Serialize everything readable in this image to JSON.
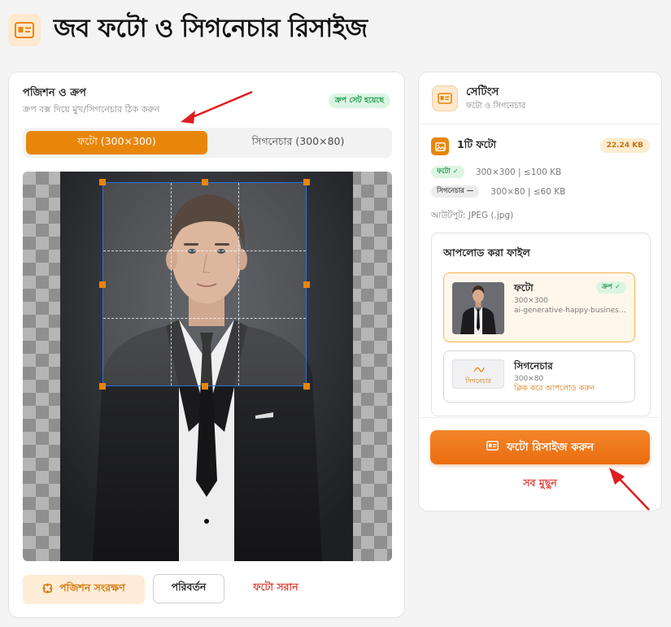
{
  "header": {
    "title": "জব ফটো ও সিগনেচার রিসাইজ",
    "icon": "id-card-icon"
  },
  "editor": {
    "title": "পজিশন ও ক্রপ",
    "subtitle": "ক্রপ বক্স দিয়ে মুখ/সিগনেচার ঠিক করুন",
    "status_badge": "ক্রপ সেট হয়েছে",
    "tabs": [
      {
        "label": "ফটো (300×300)",
        "active": true
      },
      {
        "label": "সিগনেচার (300×80)",
        "active": false
      }
    ],
    "buttons": {
      "save_position": "পজিশন সংরক্ষণ",
      "change": "পরিবর্তন",
      "remove_photo": "ফটো সরান"
    }
  },
  "settings": {
    "title": "সেটিংস",
    "subtitle": "ফটো ও সিগনেচার",
    "photo_count": "1টি ফটো",
    "total_size": "22.24 KB",
    "specs": [
      {
        "pill": "ফটো ✓",
        "text": "300×300 | ≤100 KB",
        "done": true
      },
      {
        "pill": "সিগনেচার —",
        "text": "300×80 | ≤60 KB",
        "done": false
      }
    ],
    "output_format": "আউটপুট: JPEG (.jpg)",
    "uploaded_files": {
      "title": "আপলোড করা ফাইল",
      "photo": {
        "name": "ফটো",
        "dims": "300×300",
        "filename": "ai-generative-happy-business-man-in-suit.jpg",
        "badge": "ক্রপ ✓"
      },
      "signature": {
        "name": "সিগনেচার",
        "dims": "300×80",
        "hint": "ক্লিক করে আপলোড করুন",
        "thumb_label": "সিগনেচার"
      }
    },
    "resize_button": "ফটো রিসাইজ করুন",
    "clear_button": "সব মুছুন"
  },
  "colors": {
    "accent": "#e8860a",
    "danger": "#e0433a",
    "success": "#1e9b4f"
  }
}
